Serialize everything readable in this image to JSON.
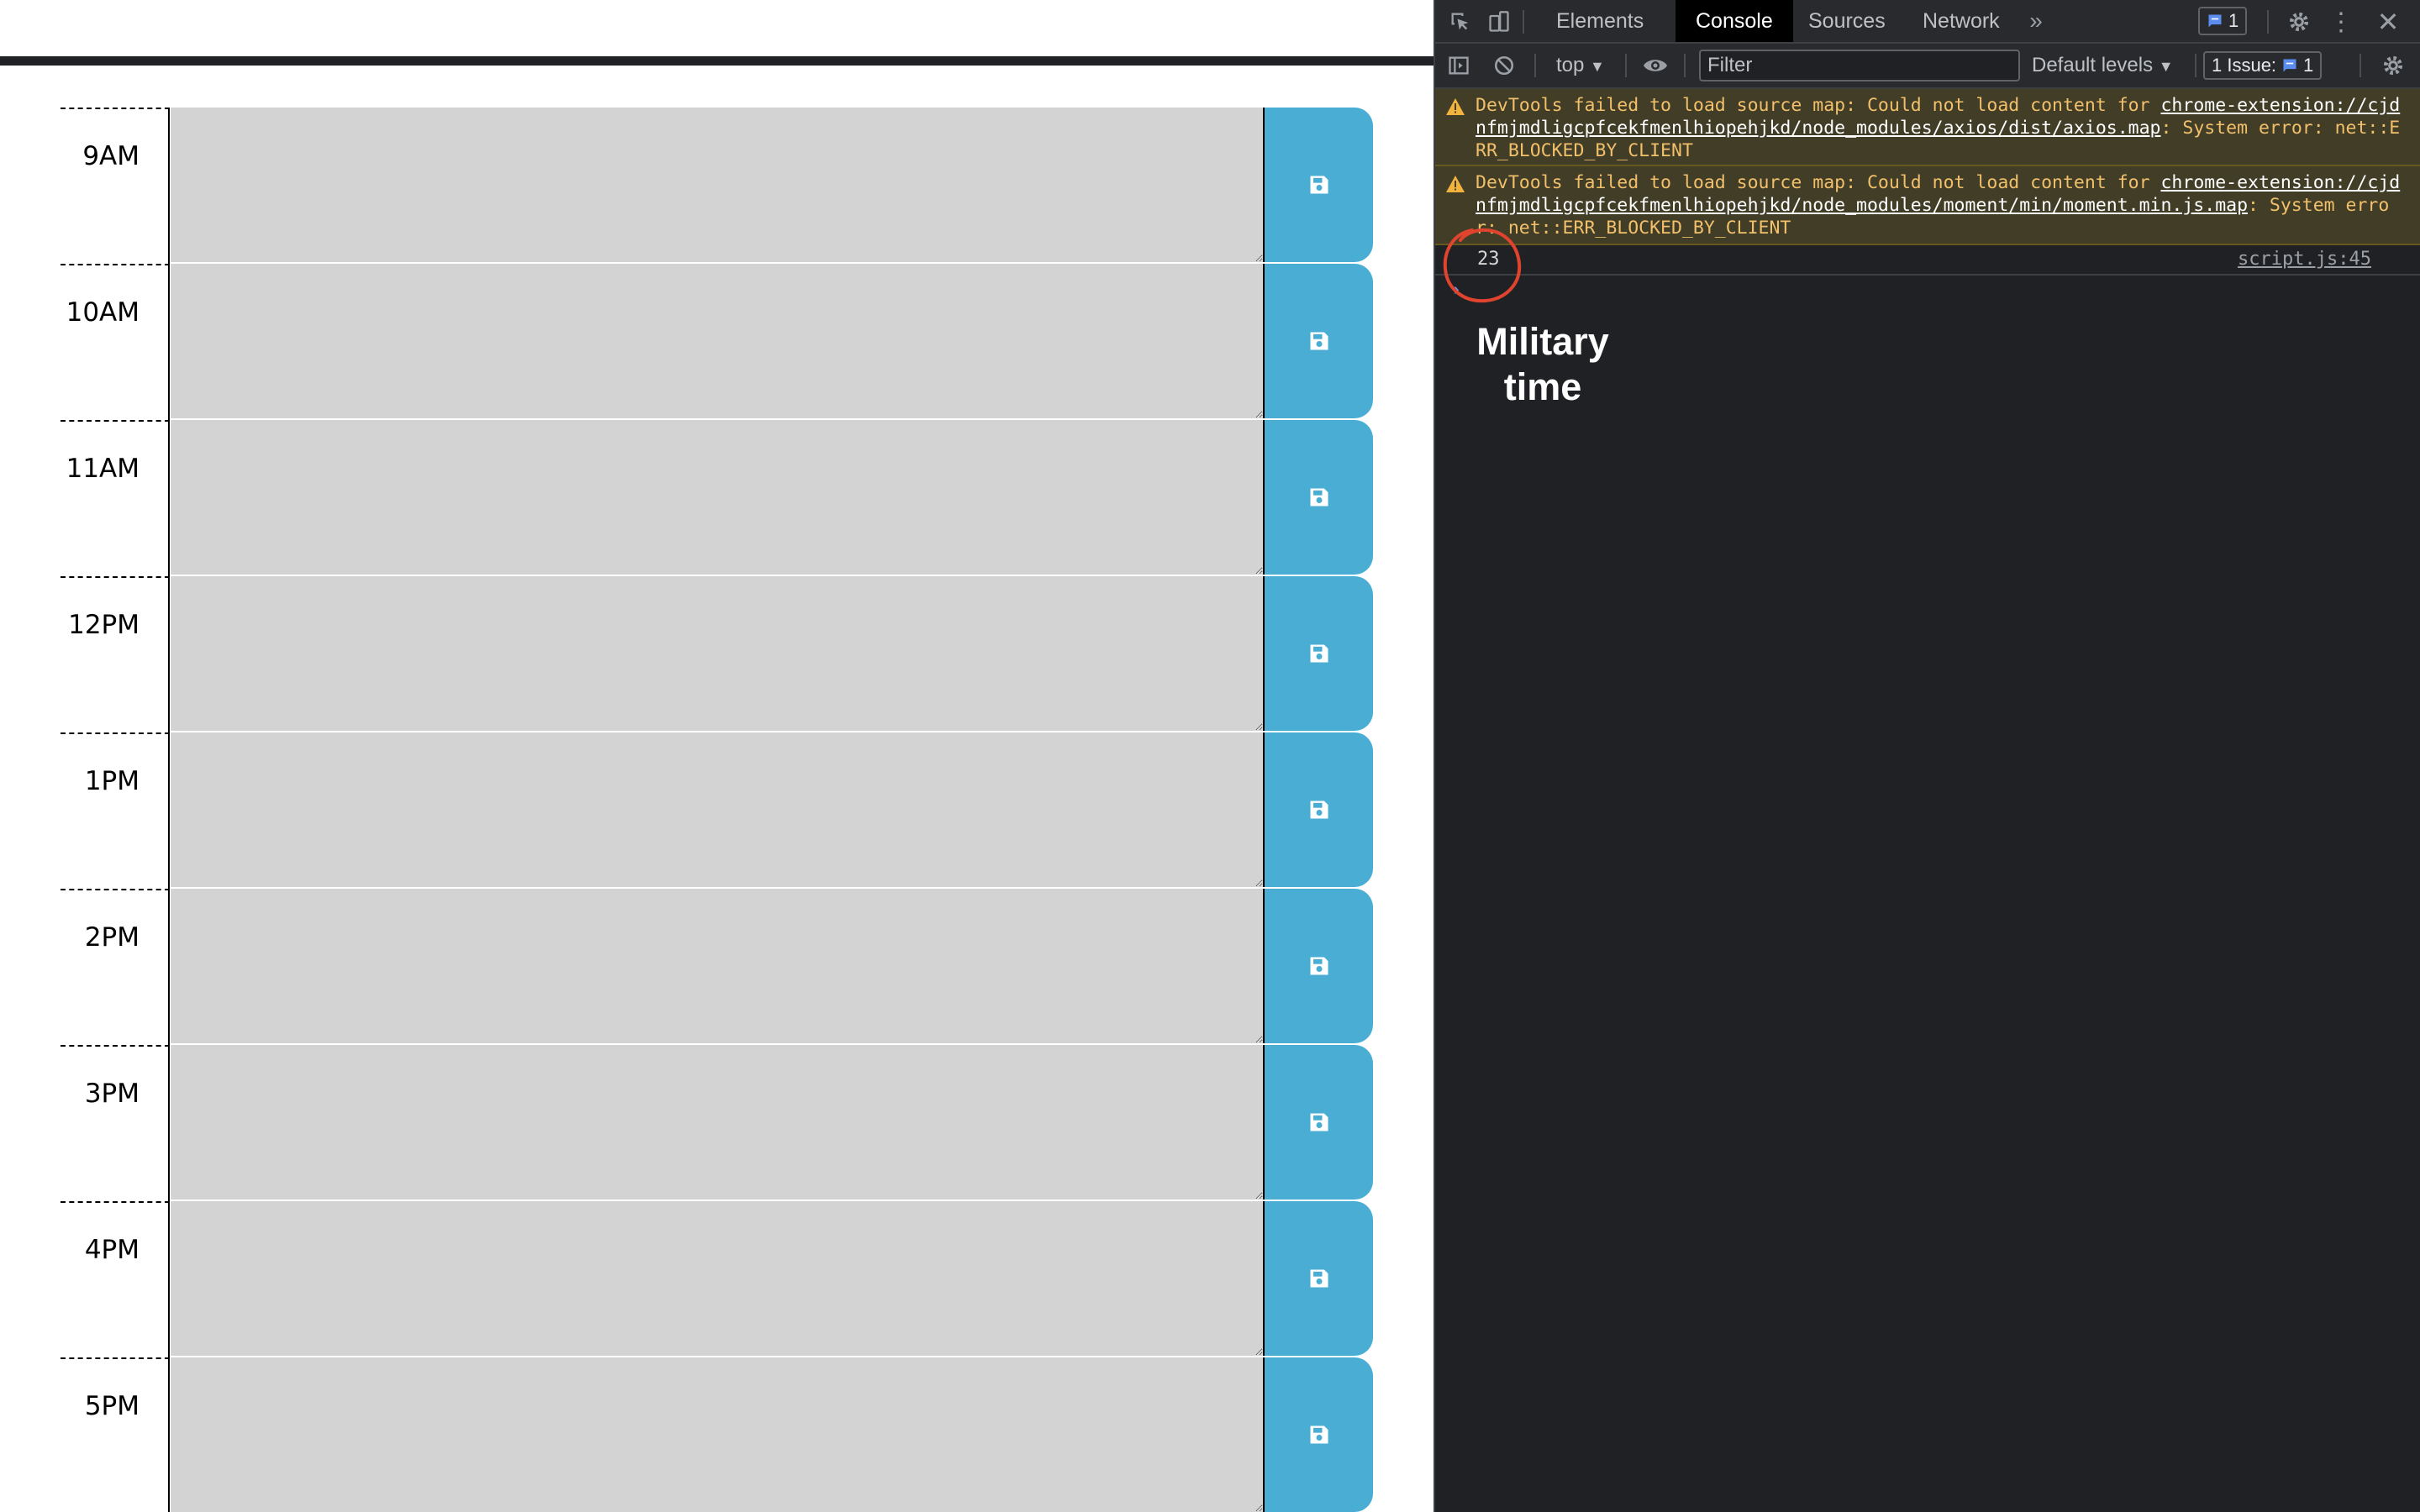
{
  "planner": {
    "rows": [
      {
        "hour": "9AM"
      },
      {
        "hour": "10AM"
      },
      {
        "hour": "11AM"
      },
      {
        "hour": "12PM"
      },
      {
        "hour": "1PM"
      },
      {
        "hour": "2PM"
      },
      {
        "hour": "3PM"
      },
      {
        "hour": "4PM"
      },
      {
        "hour": "5PM"
      }
    ],
    "save_icon": "floppy-disk-icon",
    "colors": {
      "textarea_bg": "#d3d3d3",
      "save_bg": "#4aadd3",
      "save_icon": "#ffffff"
    }
  },
  "devtools": {
    "tabs": [
      "Elements",
      "Console",
      "Sources",
      "Network"
    ],
    "active_tab": "Console",
    "more_tabs_icon": "double-chevron-right-icon",
    "messages_badge": "1",
    "toolbar": {
      "context": "top",
      "filter_placeholder": "Filter",
      "levels": "Default levels",
      "issues_label": "1 Issue:",
      "issues_count": "1"
    },
    "console": {
      "warnings": [
        {
          "prefix": "DevTools failed to load source map: Could not load content for ",
          "link": "chrome-extension://cjdnfmjmdligcpfcekfmenlhiopehjkd/node_modules/axios/dist/axios.map",
          "suffix": ": System error: net::ERR_BLOCKED_BY_CLIENT"
        },
        {
          "prefix": "DevTools failed to load source map: Could not load content for ",
          "link": "chrome-extension://cjdnfmjmdligcpfcekfmenlhiopehjkd/node_modules/moment/min/moment.min.js.map",
          "suffix": ": System error: net::ERR_BLOCKED_BY_CLIENT"
        }
      ],
      "log_value": "23",
      "log_source": "script.js:45"
    },
    "colors": {
      "panel_bg": "#202124",
      "warning_bg": "#413d27",
      "warning_text": "#f2c06b",
      "annotation": "#e0442e"
    }
  },
  "annotation": {
    "label_line1": "Military",
    "label_line2": "time"
  }
}
